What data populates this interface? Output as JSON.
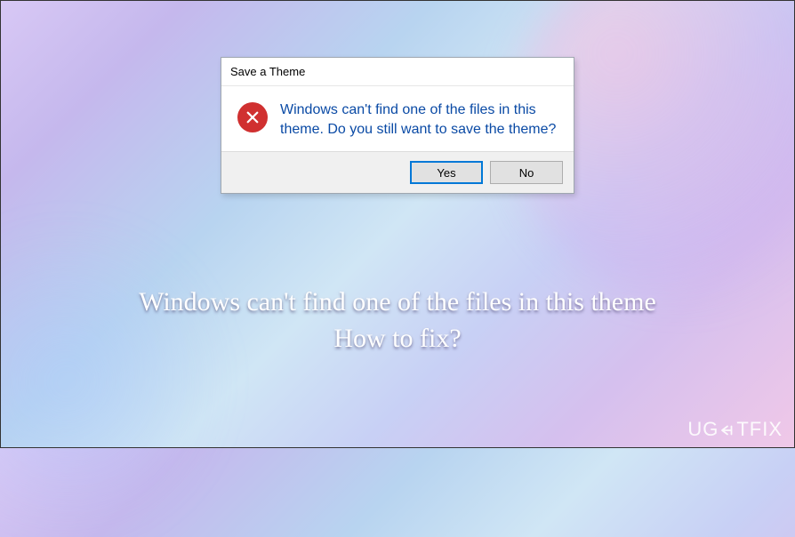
{
  "dialog": {
    "title": "Save a Theme",
    "message": "Windows can't find one of the files in this theme. Do you still want to save the theme?",
    "yes_label": "Yes",
    "no_label": "No",
    "icon": "error-x"
  },
  "caption": {
    "line1": "Windows can't find one of the files in this theme",
    "line2": "How to fix?"
  },
  "watermark": {
    "prefix": "UG",
    "suffix": "TFIX"
  }
}
